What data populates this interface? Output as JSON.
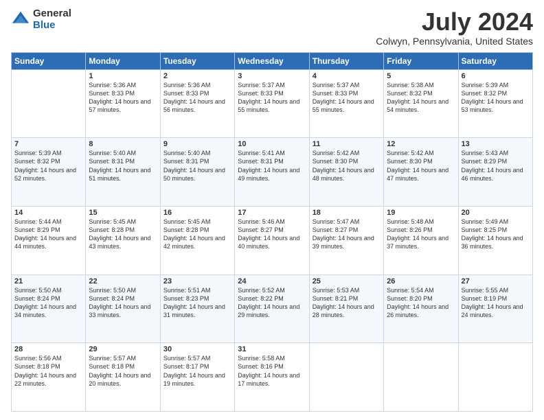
{
  "logo": {
    "general": "General",
    "blue": "Blue"
  },
  "title": "July 2024",
  "subtitle": "Colwyn, Pennsylvania, United States",
  "headers": [
    "Sunday",
    "Monday",
    "Tuesday",
    "Wednesday",
    "Thursday",
    "Friday",
    "Saturday"
  ],
  "weeks": [
    [
      {
        "day": "",
        "sunrise": "",
        "sunset": "",
        "daylight": ""
      },
      {
        "day": "1",
        "sunrise": "Sunrise: 5:36 AM",
        "sunset": "Sunset: 8:33 PM",
        "daylight": "Daylight: 14 hours and 57 minutes."
      },
      {
        "day": "2",
        "sunrise": "Sunrise: 5:36 AM",
        "sunset": "Sunset: 8:33 PM",
        "daylight": "Daylight: 14 hours and 56 minutes."
      },
      {
        "day": "3",
        "sunrise": "Sunrise: 5:37 AM",
        "sunset": "Sunset: 8:33 PM",
        "daylight": "Daylight: 14 hours and 55 minutes."
      },
      {
        "day": "4",
        "sunrise": "Sunrise: 5:37 AM",
        "sunset": "Sunset: 8:33 PM",
        "daylight": "Daylight: 14 hours and 55 minutes."
      },
      {
        "day": "5",
        "sunrise": "Sunrise: 5:38 AM",
        "sunset": "Sunset: 8:32 PM",
        "daylight": "Daylight: 14 hours and 54 minutes."
      },
      {
        "day": "6",
        "sunrise": "Sunrise: 5:39 AM",
        "sunset": "Sunset: 8:32 PM",
        "daylight": "Daylight: 14 hours and 53 minutes."
      }
    ],
    [
      {
        "day": "7",
        "sunrise": "Sunrise: 5:39 AM",
        "sunset": "Sunset: 8:32 PM",
        "daylight": "Daylight: 14 hours and 52 minutes."
      },
      {
        "day": "8",
        "sunrise": "Sunrise: 5:40 AM",
        "sunset": "Sunset: 8:31 PM",
        "daylight": "Daylight: 14 hours and 51 minutes."
      },
      {
        "day": "9",
        "sunrise": "Sunrise: 5:40 AM",
        "sunset": "Sunset: 8:31 PM",
        "daylight": "Daylight: 14 hours and 50 minutes."
      },
      {
        "day": "10",
        "sunrise": "Sunrise: 5:41 AM",
        "sunset": "Sunset: 8:31 PM",
        "daylight": "Daylight: 14 hours and 49 minutes."
      },
      {
        "day": "11",
        "sunrise": "Sunrise: 5:42 AM",
        "sunset": "Sunset: 8:30 PM",
        "daylight": "Daylight: 14 hours and 48 minutes."
      },
      {
        "day": "12",
        "sunrise": "Sunrise: 5:42 AM",
        "sunset": "Sunset: 8:30 PM",
        "daylight": "Daylight: 14 hours and 47 minutes."
      },
      {
        "day": "13",
        "sunrise": "Sunrise: 5:43 AM",
        "sunset": "Sunset: 8:29 PM",
        "daylight": "Daylight: 14 hours and 46 minutes."
      }
    ],
    [
      {
        "day": "14",
        "sunrise": "Sunrise: 5:44 AM",
        "sunset": "Sunset: 8:29 PM",
        "daylight": "Daylight: 14 hours and 44 minutes."
      },
      {
        "day": "15",
        "sunrise": "Sunrise: 5:45 AM",
        "sunset": "Sunset: 8:28 PM",
        "daylight": "Daylight: 14 hours and 43 minutes."
      },
      {
        "day": "16",
        "sunrise": "Sunrise: 5:45 AM",
        "sunset": "Sunset: 8:28 PM",
        "daylight": "Daylight: 14 hours and 42 minutes."
      },
      {
        "day": "17",
        "sunrise": "Sunrise: 5:46 AM",
        "sunset": "Sunset: 8:27 PM",
        "daylight": "Daylight: 14 hours and 40 minutes."
      },
      {
        "day": "18",
        "sunrise": "Sunrise: 5:47 AM",
        "sunset": "Sunset: 8:27 PM",
        "daylight": "Daylight: 14 hours and 39 minutes."
      },
      {
        "day": "19",
        "sunrise": "Sunrise: 5:48 AM",
        "sunset": "Sunset: 8:26 PM",
        "daylight": "Daylight: 14 hours and 37 minutes."
      },
      {
        "day": "20",
        "sunrise": "Sunrise: 5:49 AM",
        "sunset": "Sunset: 8:25 PM",
        "daylight": "Daylight: 14 hours and 36 minutes."
      }
    ],
    [
      {
        "day": "21",
        "sunrise": "Sunrise: 5:50 AM",
        "sunset": "Sunset: 8:24 PM",
        "daylight": "Daylight: 14 hours and 34 minutes."
      },
      {
        "day": "22",
        "sunrise": "Sunrise: 5:50 AM",
        "sunset": "Sunset: 8:24 PM",
        "daylight": "Daylight: 14 hours and 33 minutes."
      },
      {
        "day": "23",
        "sunrise": "Sunrise: 5:51 AM",
        "sunset": "Sunset: 8:23 PM",
        "daylight": "Daylight: 14 hours and 31 minutes."
      },
      {
        "day": "24",
        "sunrise": "Sunrise: 5:52 AM",
        "sunset": "Sunset: 8:22 PM",
        "daylight": "Daylight: 14 hours and 29 minutes."
      },
      {
        "day": "25",
        "sunrise": "Sunrise: 5:53 AM",
        "sunset": "Sunset: 8:21 PM",
        "daylight": "Daylight: 14 hours and 28 minutes."
      },
      {
        "day": "26",
        "sunrise": "Sunrise: 5:54 AM",
        "sunset": "Sunset: 8:20 PM",
        "daylight": "Daylight: 14 hours and 26 minutes."
      },
      {
        "day": "27",
        "sunrise": "Sunrise: 5:55 AM",
        "sunset": "Sunset: 8:19 PM",
        "daylight": "Daylight: 14 hours and 24 minutes."
      }
    ],
    [
      {
        "day": "28",
        "sunrise": "Sunrise: 5:56 AM",
        "sunset": "Sunset: 8:18 PM",
        "daylight": "Daylight: 14 hours and 22 minutes."
      },
      {
        "day": "29",
        "sunrise": "Sunrise: 5:57 AM",
        "sunset": "Sunset: 8:18 PM",
        "daylight": "Daylight: 14 hours and 20 minutes."
      },
      {
        "day": "30",
        "sunrise": "Sunrise: 5:57 AM",
        "sunset": "Sunset: 8:17 PM",
        "daylight": "Daylight: 14 hours and 19 minutes."
      },
      {
        "day": "31",
        "sunrise": "Sunrise: 5:58 AM",
        "sunset": "Sunset: 8:16 PM",
        "daylight": "Daylight: 14 hours and 17 minutes."
      },
      {
        "day": "",
        "sunrise": "",
        "sunset": "",
        "daylight": ""
      },
      {
        "day": "",
        "sunrise": "",
        "sunset": "",
        "daylight": ""
      },
      {
        "day": "",
        "sunrise": "",
        "sunset": "",
        "daylight": ""
      }
    ]
  ]
}
